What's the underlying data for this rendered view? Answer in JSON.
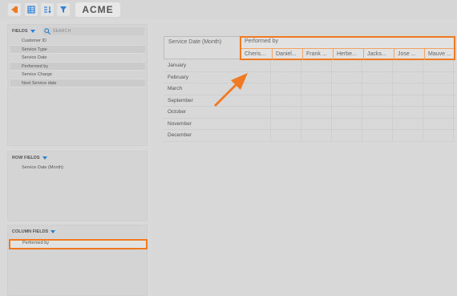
{
  "toolbar": {
    "brand": "ACME",
    "icons": [
      "export-icon",
      "table-icon",
      "sort-icon",
      "filter-icon"
    ],
    "accent_orange": "#f07a22",
    "accent_blue": "#2d7fd3"
  },
  "fields_panel": {
    "title": "FIELDS",
    "search_placeholder": "SEARCH",
    "items": [
      "Customer ID",
      "Service Type",
      "Service Date",
      "Performed by",
      "Service Charge",
      "Next Service date"
    ]
  },
  "row_fields_panel": {
    "title": "ROW FIELDS",
    "items": [
      "Service Date (Month)"
    ]
  },
  "column_fields_panel": {
    "title": "COLUMN FIELDS",
    "items": [
      "Performed by"
    ]
  },
  "pivot": {
    "row_header": "Service Date (Month)",
    "column_group": "Performed by",
    "columns": [
      "Cheris...",
      "Daniel...",
      "Frank ...",
      "Herbe...",
      "Jacks...",
      "Jose ...",
      "Mauve ..."
    ],
    "rows": [
      "January",
      "February",
      "March",
      "September",
      "October",
      "November",
      "December"
    ]
  }
}
